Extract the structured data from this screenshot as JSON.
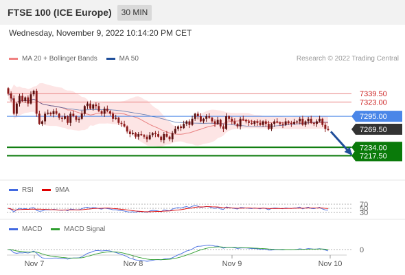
{
  "header": {
    "title": "FTSE 100 (ICE Europe)",
    "timeframe": "30 MIN"
  },
  "datetime": "Wednesday, November 9, 2022 10:14:20 PM CET",
  "price_legend": [
    {
      "label": "MA 20 + Bollinger Bands",
      "color": "#f08080"
    },
    {
      "label": "MA 50",
      "color": "#1f4e9a"
    }
  ],
  "credit": "Research © 2022 Trading Central",
  "rsi_legend": [
    {
      "label": "RSI",
      "color": "#4169e1"
    },
    {
      "label": "9MA",
      "color": "#e00000"
    }
  ],
  "macd_legend": [
    {
      "label": "MACD",
      "color": "#4169e1"
    },
    {
      "label": "MACD Signal",
      "color": "#2e9e2e"
    }
  ],
  "colors": {
    "bull_candle": "#5a0f0f",
    "bear_candle": "#8b1a1a",
    "bollinger_fill": "#fde0e0",
    "resistance": "#e88080",
    "current_price": "#4a86e8",
    "support": "#0a7a0a",
    "arrow": "#1f4e9a"
  },
  "chart_data": [
    {
      "type": "candlestick",
      "title": "FTSE 100 (ICE Europe)",
      "x_ticks": [
        "Nov 7",
        "Nov 8",
        "Nov 9",
        "Nov 10"
      ],
      "ylim": [
        7175,
        7395
      ],
      "levels": [
        {
          "value": 7339.5,
          "label": "7339.50",
          "kind": "resistance"
        },
        {
          "value": 7323.0,
          "label": "7323.00",
          "kind": "resistance"
        },
        {
          "value": 7295.0,
          "label": "7295.00",
          "kind": "current"
        },
        {
          "value": 7269.5,
          "label": "7269.50",
          "kind": "last"
        },
        {
          "value": 7234.0,
          "label": "7234.00",
          "kind": "support"
        },
        {
          "value": 7217.5,
          "label": "7217.50",
          "kind": "support"
        }
      ],
      "forecast_arrow": {
        "from": 7265,
        "to": 7220,
        "direction": "down"
      },
      "close": [
        7340,
        7330,
        7300,
        7320,
        7335,
        7325,
        7332,
        7320,
        7338,
        7345,
        7300,
        7280,
        7285,
        7300,
        7302,
        7299,
        7305,
        7300,
        7292,
        7290,
        7295,
        7282,
        7300,
        7295,
        7288,
        7290,
        7300,
        7315,
        7320,
        7310,
        7318,
        7315,
        7305,
        7300,
        7310,
        7305,
        7300,
        7290,
        7292,
        7282,
        7280,
        7275,
        7265,
        7260,
        7262,
        7255,
        7260,
        7258,
        7255,
        7250,
        7258,
        7262,
        7260,
        7255,
        7248,
        7260,
        7255,
        7250,
        7262,
        7270,
        7275,
        7272,
        7280,
        7285,
        7278,
        7290,
        7300,
        7295,
        7285,
        7290,
        7295,
        7292,
        7285,
        7280,
        7288,
        7275,
        7270,
        7295,
        7290,
        7285,
        7280,
        7275,
        7290,
        7288,
        7285,
        7282,
        7280,
        7285,
        7282,
        7278,
        7285,
        7280,
        7270,
        7280,
        7285,
        7283,
        7280,
        7278,
        7285,
        7282,
        7280,
        7284,
        7285,
        7290,
        7278,
        7285,
        7290,
        7282,
        7280,
        7285,
        7290,
        7278,
        7270,
        7268
      ]
    },
    {
      "type": "line",
      "title": "RSI",
      "series": [
        {
          "name": "RSI"
        },
        {
          "name": "9MA"
        }
      ],
      "y_ticks": [
        70,
        50,
        30
      ],
      "ylim": [
        0,
        100
      ]
    },
    {
      "type": "line",
      "title": "MACD",
      "series": [
        {
          "name": "MACD"
        },
        {
          "name": "MACD Signal"
        }
      ],
      "y_ticks": [
        0
      ]
    }
  ]
}
